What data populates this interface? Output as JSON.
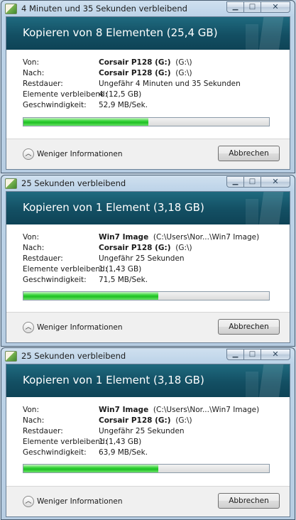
{
  "dialogs": [
    {
      "window_title": "4 Minuten und 35 Sekunden verbleibend",
      "header": "Kopieren von 8 Elementen (25,4 GB)",
      "rows": [
        {
          "label": "Von:",
          "name": "Corsair P128 (G:)",
          "path": "(G:\\)"
        },
        {
          "label": "Nach:",
          "name": "Corsair P128 (G:)",
          "path": "(G:\\)"
        },
        {
          "label": "Restdauer:",
          "value": "Ungefähr 4 Minuten und 35 Sekunden"
        },
        {
          "label": "Elemente verbleibend:",
          "value": "4 (12,5 GB)"
        },
        {
          "label": "Geschwindigkeit:",
          "value": "52,9 MB/Sek."
        }
      ],
      "progress": 0.51,
      "less_info": "Weniger Informationen",
      "cancel": "Abbrechen",
      "progress_color": "#26c42b"
    },
    {
      "window_title": "25 Sekunden verbleibend",
      "header": "Kopieren von 1 Element (3,18 GB)",
      "rows": [
        {
          "label": "Von:",
          "name": "Win7 Image",
          "path": "(C:\\Users\\Nor...\\Win7 Image)"
        },
        {
          "label": "Nach:",
          "name": "Corsair P128 (G:)",
          "path": "(G:\\)"
        },
        {
          "label": "Restdauer:",
          "value": "Ungefähr 25 Sekunden"
        },
        {
          "label": "Elemente verbleibend:",
          "value": "1 (1,43 GB)"
        },
        {
          "label": "Geschwindigkeit:",
          "value": "71,5 MB/Sek."
        }
      ],
      "progress": 0.55,
      "less_info": "Weniger Informationen",
      "cancel": "Abbrechen",
      "progress_color": "#26c42b"
    },
    {
      "window_title": "25 Sekunden verbleibend",
      "header": "Kopieren von 1 Element (3,18 GB)",
      "rows": [
        {
          "label": "Von:",
          "name": "Win7 Image",
          "path": "(C:\\Users\\Nor...\\Win7 Image)"
        },
        {
          "label": "Nach:",
          "name": "Corsair P128 (G:)",
          "path": "(G:\\)"
        },
        {
          "label": "Restdauer:",
          "value": "Ungefähr 25 Sekunden"
        },
        {
          "label": "Elemente verbleibend:",
          "value": "1 (1,43 GB)"
        },
        {
          "label": "Geschwindigkeit:",
          "value": "63,9 MB/Sek."
        }
      ],
      "progress": 0.55,
      "less_info": "Weniger Informationen",
      "cancel": "Abbrechen",
      "progress_color": "#26c42b"
    }
  ],
  "icons": {
    "app": "copy-files-icon",
    "minimize": "minimize-icon",
    "maximize": "maximize-icon",
    "close": "close-icon",
    "toggle": "chevron-up-icon"
  },
  "header_color": "#15586c"
}
